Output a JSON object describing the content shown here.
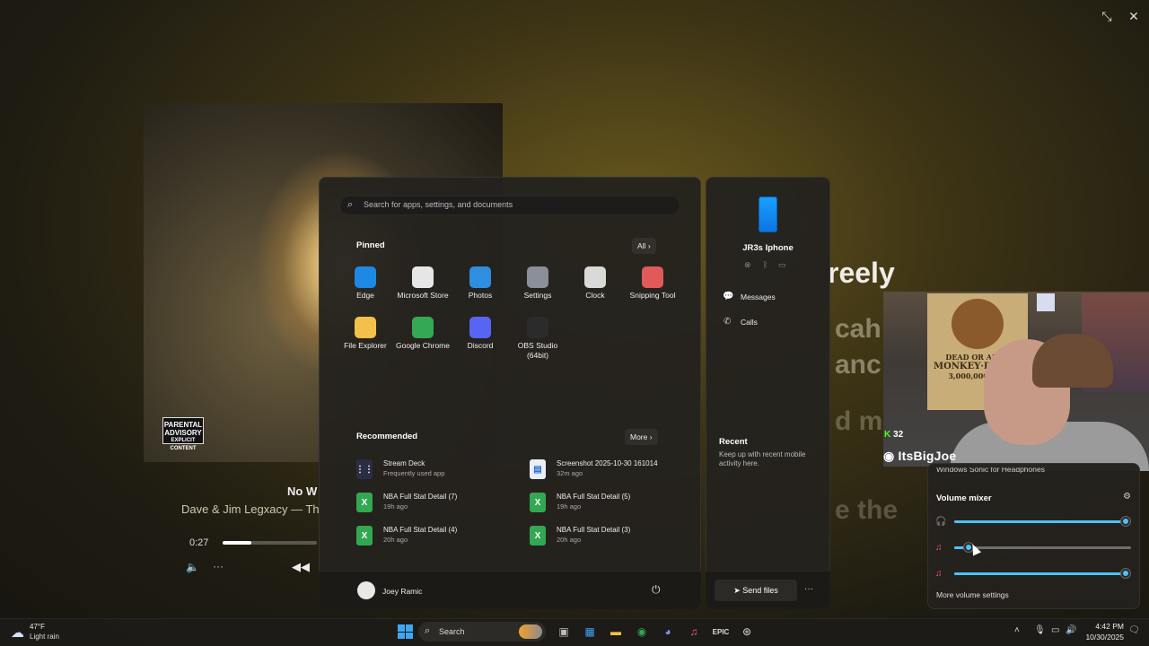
{
  "window_controls": {
    "restore_icon": "↘↖",
    "close_icon": "✕"
  },
  "player": {
    "advisory_line1": "PARENTAL",
    "advisory_line2": "ADVISORY",
    "advisory_line3": "EXPLICIT CONTENT",
    "song_title": "No W",
    "artist": "Dave & Jim Legxacy — Th",
    "elapsed": "0:27",
    "progress_fraction": 0.3
  },
  "lyrics": {
    "line1": "reely",
    "line2": "cah",
    "line3": "anc",
    "line4": "d m",
    "line5": "e the"
  },
  "start_menu": {
    "search_placeholder": "Search for apps, settings, and documents",
    "pinned_heading": "Pinned",
    "all_button": "All",
    "pinned": [
      {
        "label": "Edge",
        "icon": "edge-icon",
        "color": "#1e88e5"
      },
      {
        "label": "Microsoft Store",
        "icon": "store-icon",
        "color": "#e6e6e6"
      },
      {
        "label": "Photos",
        "icon": "photos-icon",
        "color": "#2e8fe0"
      },
      {
        "label": "Settings",
        "icon": "gear-icon",
        "color": "#8a8f99"
      },
      {
        "label": "Clock",
        "icon": "clock-icon",
        "color": "#d9d9d9"
      },
      {
        "label": "Snipping Tool",
        "icon": "snipping-tool-icon",
        "color": "#e05a5a"
      },
      {
        "label": "File Explorer",
        "icon": "folder-icon",
        "color": "#f3c04a"
      },
      {
        "label": "Google Chrome",
        "icon": "chrome-icon",
        "color": "#34a853"
      },
      {
        "label": "Discord",
        "icon": "discord-icon",
        "color": "#5865f2"
      },
      {
        "label": "OBS Studio (64bit)",
        "icon": "obs-icon",
        "color": "#2b2b2b"
      }
    ],
    "recommended_heading": "Recommended",
    "more_button": "More",
    "recommended": [
      {
        "title": "Stream Deck",
        "sub": "Frequently used app",
        "icon": "stream-deck-icon",
        "color": "#2c2c44"
      },
      {
        "title": "Screenshot 2025-10-30 161014",
        "sub": "32m ago",
        "icon": "image-file-icon",
        "color": "#e9eef7"
      },
      {
        "title": "NBA Full Stat Detail (7)",
        "sub": "19h ago",
        "icon": "excel-icon",
        "color": "#33a852"
      },
      {
        "title": "NBA Full Stat Detail (5)",
        "sub": "19h ago",
        "icon": "excel-icon",
        "color": "#33a852"
      },
      {
        "title": "NBA Full Stat Detail (4)",
        "sub": "20h ago",
        "icon": "excel-icon",
        "color": "#33a852"
      },
      {
        "title": "NBA Full Stat Detail (3)",
        "sub": "20h ago",
        "icon": "excel-icon",
        "color": "#33a852"
      }
    ],
    "user_name": "Joey Ramic"
  },
  "phone_panel": {
    "device_name": "JR3s Iphone",
    "messages": "Messages",
    "calls": "Calls",
    "recent_heading": "Recent",
    "recent_sub": "Keep up with recent mobile activity here.",
    "send_files": "Send files"
  },
  "webcam": {
    "poster_line1": "DEAD OR ALIVE",
    "poster_line2": "MONKEY·D·LUFFY",
    "poster_line3": "3,000,000,000-",
    "kick_count": "32",
    "kick_letter": "K",
    "discord_name": "ItsBigJoe"
  },
  "volume_mixer": {
    "device_cut": "Windows Sonic for Headphones",
    "title": "Volume mixer",
    "more_settings": "More volume settings",
    "levels": [
      0.97,
      0.08,
      0.97
    ]
  },
  "taskbar": {
    "temperature": "47°F",
    "weather": "Light rain",
    "search": "Search",
    "time": "4:42 PM",
    "date": "10/30/2025"
  },
  "colors": {
    "accent": "#4cc2ff",
    "windows_blue": "#3da7f4"
  }
}
